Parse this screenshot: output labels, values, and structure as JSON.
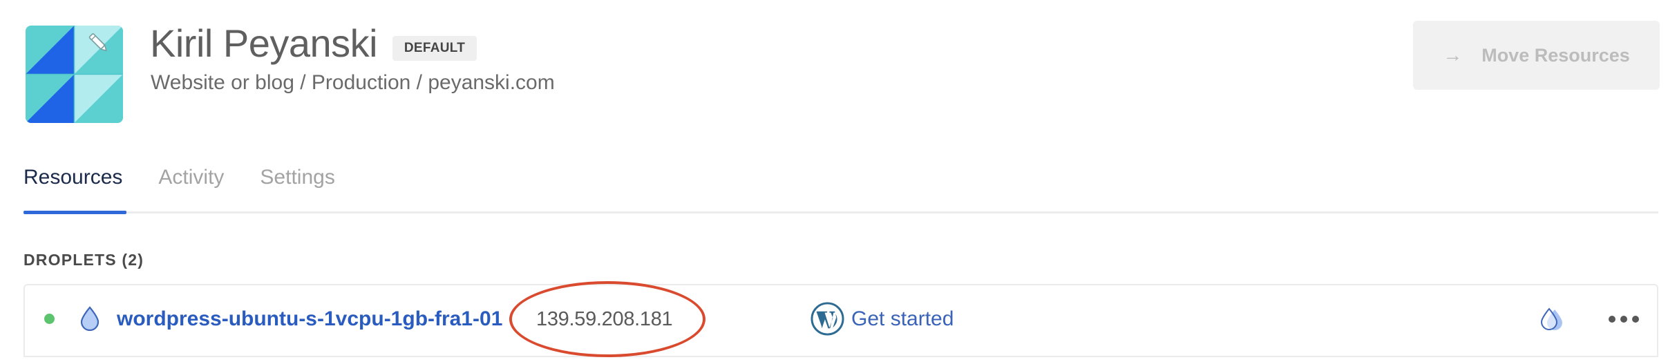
{
  "project": {
    "name": "Kiril Peyanski",
    "badge": "DEFAULT",
    "subtitle": "Website or blog / Production / peyanski.com",
    "logo_icon": "project-logo-icon",
    "edit_icon": "pencil-icon"
  },
  "toolbar": {
    "move_resources_label": "Move Resources",
    "move_resources_icon": "→"
  },
  "tabs": [
    {
      "label": "Resources",
      "active": true
    },
    {
      "label": "Activity",
      "active": false
    },
    {
      "label": "Settings",
      "active": false
    }
  ],
  "droplets": {
    "section_label": "DROPLETS (2)",
    "rows": [
      {
        "status": "active",
        "status_color": "#5cc36f",
        "name": "wordpress-ubuntu-s-1vcpu-1gb-fra1-01",
        "ip": "139.59.208.181",
        "app_icon": "wordpress-icon",
        "action_label": "Get started",
        "extra_icon": "backups-icon",
        "menu_icon": "ellipsis-icon"
      }
    ]
  },
  "colors": {
    "accent": "#2f68d8",
    "link": "#2a5cc0",
    "highlight": "#d94a2e",
    "logo_teal": "#5ccfd0",
    "logo_blue": "#1f63e6",
    "logo_light": "#b2ecef"
  }
}
